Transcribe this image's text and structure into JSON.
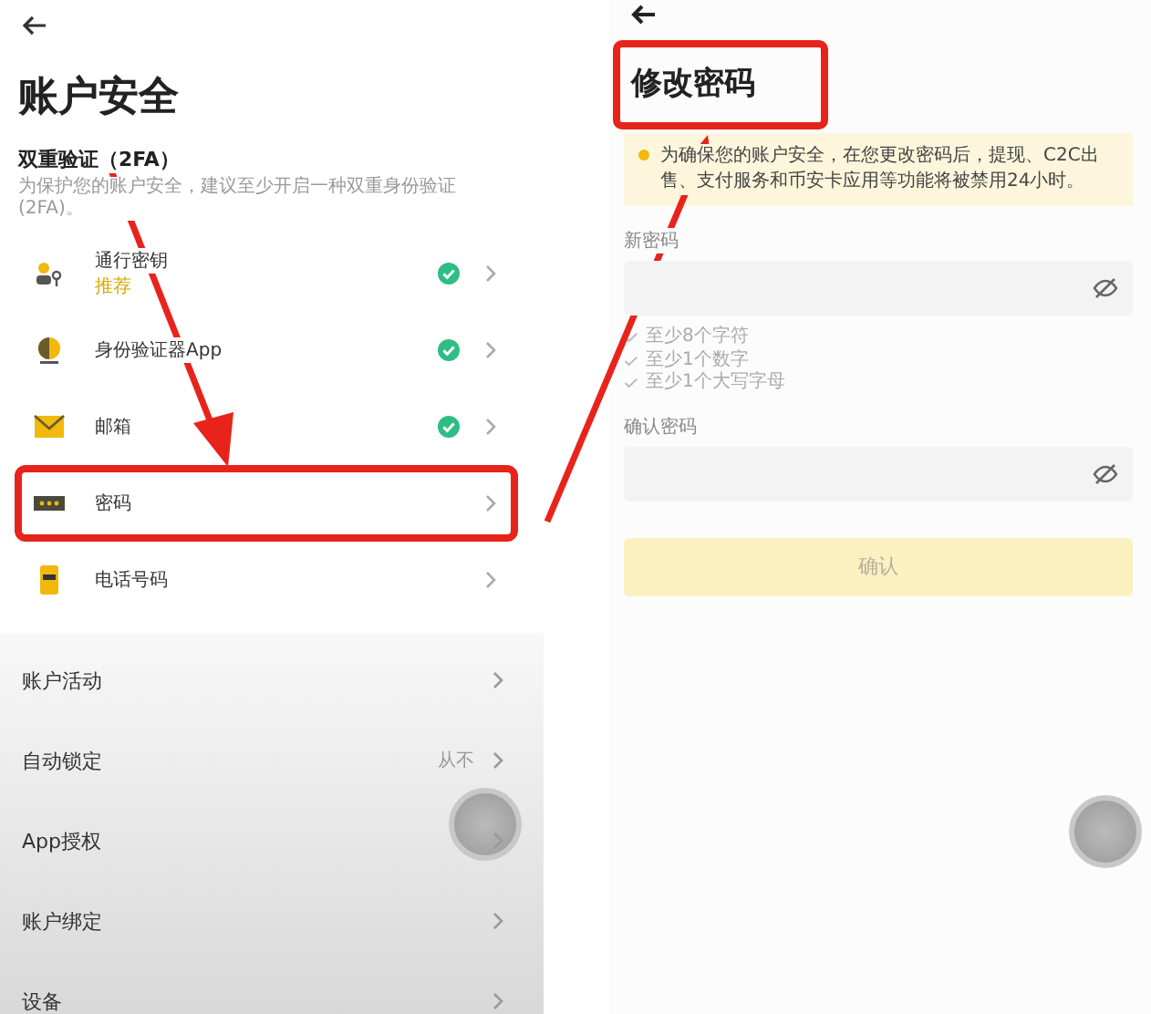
{
  "left_screen": {
    "title": "账户安全",
    "two_factor": {
      "heading": "双重验证（2FA）",
      "description": "为保护您的账户安全，建议至少开启一种双重身份验证(2FA)。"
    },
    "security_items": [
      {
        "kind": "passkey",
        "label": "通行密钥",
        "badge": "推荐",
        "enabled": true,
        "highlighted": false
      },
      {
        "kind": "authenticator",
        "label": "身份验证器App",
        "enabled": true,
        "highlighted": false
      },
      {
        "kind": "email",
        "label": "邮箱",
        "enabled": true,
        "highlighted": false
      },
      {
        "kind": "password",
        "label": "密码",
        "enabled": false,
        "highlighted": true
      },
      {
        "kind": "phone",
        "label": "电话号码",
        "enabled": false,
        "highlighted": false
      }
    ],
    "settings": [
      {
        "label": "账户活动"
      },
      {
        "label": "自动锁定",
        "value": "从不"
      },
      {
        "label": "App授权"
      },
      {
        "label": "账户绑定"
      },
      {
        "label": "设备"
      }
    ]
  },
  "right_screen": {
    "title": "修改密码",
    "title_highlighted": true,
    "notice": "为确保您的账户安全，在您更改密码后，提现、C2C出售、支付服务和币安卡应用等功能将被禁用24小时。",
    "new_password": {
      "label": "新密码"
    },
    "rules": [
      "至少8个字符",
      "至少1个数字",
      "至少1个大写字母"
    ],
    "confirm_password": {
      "label": "确认密码"
    },
    "submit": {
      "label": "确认",
      "disabled": true
    }
  }
}
